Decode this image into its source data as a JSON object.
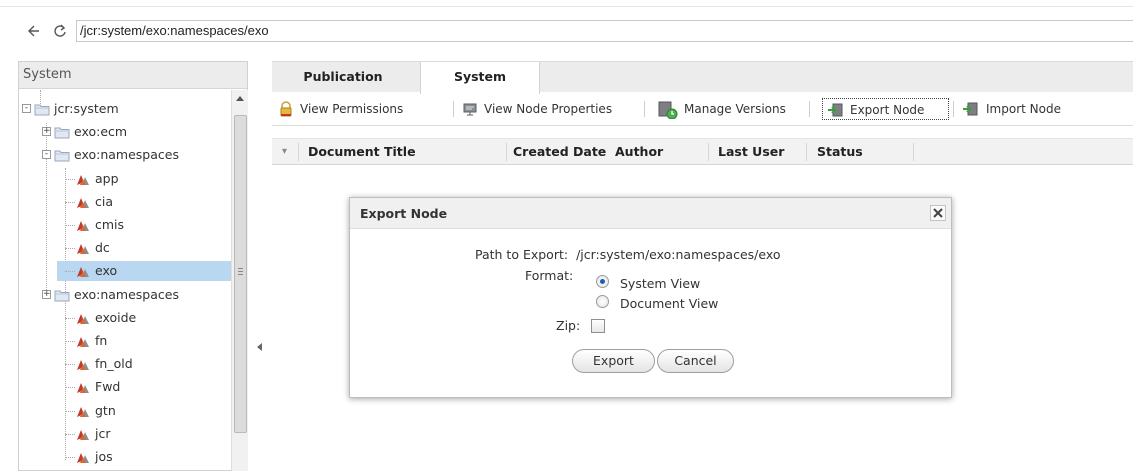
{
  "address": {
    "path": "/jcr:system/exo:namespaces/exo"
  },
  "icons": {
    "back": "back-arrow-icon",
    "reload": "reload-icon"
  },
  "left_panel": {
    "title": "System",
    "tree": [
      {
        "label": "jcr:system",
        "kind": "folder",
        "expander": "-"
      },
      {
        "label": "exo:ecm",
        "kind": "folder",
        "expander": "+"
      },
      {
        "label": "exo:namespaces",
        "kind": "folder",
        "expander": "-"
      },
      {
        "label": "app",
        "kind": "node"
      },
      {
        "label": "cia",
        "kind": "node"
      },
      {
        "label": "cmis",
        "kind": "node"
      },
      {
        "label": "dc",
        "kind": "node"
      },
      {
        "label": "exo",
        "kind": "node",
        "selected": true
      },
      {
        "label": "exo:namespaces",
        "kind": "folder",
        "expander": "+"
      },
      {
        "label": "exoide",
        "kind": "node"
      },
      {
        "label": "fn",
        "kind": "node"
      },
      {
        "label": "fn_old",
        "kind": "node"
      },
      {
        "label": "Fwd",
        "kind": "node"
      },
      {
        "label": "gtn",
        "kind": "node"
      },
      {
        "label": "jcr",
        "kind": "node"
      },
      {
        "label": "jos",
        "kind": "node"
      }
    ]
  },
  "tabs": [
    {
      "label": "Publication",
      "active": false
    },
    {
      "label": "System",
      "active": true
    }
  ],
  "toolbar": [
    {
      "label": "View Permissions",
      "icon": "lock-icon"
    },
    {
      "label": "View Node Properties",
      "icon": "properties-icon"
    },
    {
      "label": "Manage Versions",
      "icon": "versions-icon"
    },
    {
      "label": "Export Node",
      "icon": "export-icon",
      "focused": true
    },
    {
      "label": "Import Node",
      "icon": "import-icon"
    }
  ],
  "columns": [
    "Document Title",
    "Created Date",
    "Author",
    "Last User",
    "Status"
  ],
  "dialog": {
    "title": "Export Node",
    "path_label": "Path to Export:",
    "path_value": "/jcr:system/exo:namespaces/exo",
    "format_label": "Format:",
    "format_options": [
      {
        "label": "System View",
        "selected": true
      },
      {
        "label": "Document View",
        "selected": false
      }
    ],
    "zip_label": "Zip:",
    "zip_checked": false,
    "export_button": "Export",
    "cancel_button": "Cancel"
  },
  "colors": {
    "selection": "#b9d7f1",
    "radio_selected": "#1d5fb4"
  }
}
